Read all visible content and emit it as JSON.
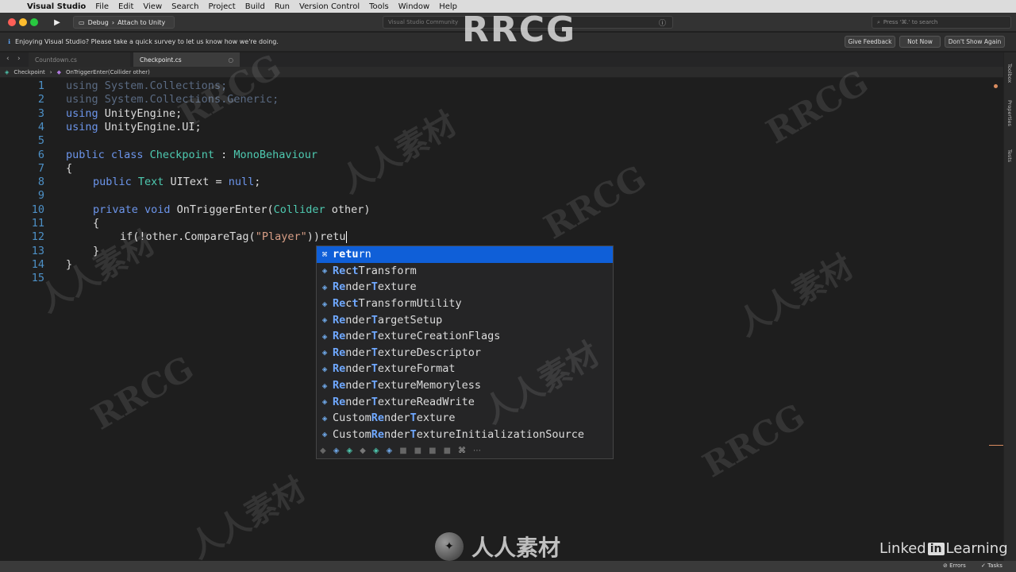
{
  "menubar": {
    "app": "Visual Studio",
    "items": [
      "File",
      "Edit",
      "View",
      "Search",
      "Project",
      "Build",
      "Run",
      "Version Control",
      "Tools",
      "Window",
      "Help"
    ]
  },
  "toolbar": {
    "config": "Debug",
    "target": "Attach to Unity",
    "status": "Visual Studio Community",
    "search_placeholder": "Press '⌘.' to search"
  },
  "infobar": {
    "message": "Enjoying Visual Studio? Please take a quick survey to let us know how we're doing.",
    "buttons": [
      "Give Feedback",
      "Not Now",
      "Don't Show Again"
    ]
  },
  "tabs": [
    {
      "label": "Countdown.cs",
      "active": false
    },
    {
      "label": "Checkpoint.cs",
      "active": true
    }
  ],
  "breadcrumb": [
    "Checkpoint",
    "OnTriggerEnter(Collider other)"
  ],
  "right_panels": [
    "Toolbox",
    "Properties",
    "Tests"
  ],
  "line_numbers": [
    "1",
    "2",
    "3",
    "4",
    "5",
    "6",
    "7",
    "8",
    "9",
    "10",
    "11",
    "12",
    "13",
    "14",
    "15"
  ],
  "code": {
    "l1_kw": "using",
    "l1_rest": " System.Collections;",
    "l2_kw": "using",
    "l2_rest": " System.Collections.Generic;",
    "l3_kw": "using",
    "l3_rest": " UnityEngine;",
    "l4_kw": "using",
    "l4_rest": " UnityEngine.UI;",
    "l6_kw": "public class",
    "l6_name": " Checkpoint",
    "l6_sep": " : ",
    "l6_base": "MonoBehaviour",
    "l7": "{",
    "l8_kw": "public",
    "l8_type": " Text",
    "l8_rest": " UIText = ",
    "l8_null": "null",
    "l8_end": ";",
    "l10_kw": "private void",
    "l10_name": " OnTriggerEnter(",
    "l10_type": "Collider",
    "l10_end": " other)",
    "l11": "{",
    "l12_a": "if(!other.CompareTag(",
    "l12_str": "\"Player\"",
    "l12_b": "))retu",
    "l13": "}",
    "l14": "}"
  },
  "completion": {
    "items": [
      {
        "icon": "⌘",
        "pre": "",
        "hl1": "retu",
        "mid": "rn",
        "hl2": "",
        "post": "",
        "selected": true
      },
      {
        "icon": "◈",
        "pre": "",
        "hl1": "Re",
        "mid": "c",
        "hl2": "t",
        "post": "Transform"
      },
      {
        "icon": "◈",
        "pre": "",
        "hl1": "Re",
        "mid": "nder",
        "hl2": "T",
        "post": "exture"
      },
      {
        "icon": "◈",
        "pre": "",
        "hl1": "Re",
        "mid": "c",
        "hl2": "t",
        "post": "TransformUtility"
      },
      {
        "icon": "◈",
        "pre": "",
        "hl1": "Re",
        "mid": "nder",
        "hl2": "T",
        "post": "argetSetup"
      },
      {
        "icon": "◈",
        "pre": "",
        "hl1": "Re",
        "mid": "nder",
        "hl2": "T",
        "post": "extureCreationFlags"
      },
      {
        "icon": "◈",
        "pre": "",
        "hl1": "Re",
        "mid": "nder",
        "hl2": "T",
        "post": "extureDescriptor"
      },
      {
        "icon": "◈",
        "pre": "",
        "hl1": "Re",
        "mid": "nder",
        "hl2": "T",
        "post": "extureFormat"
      },
      {
        "icon": "◈",
        "pre": "",
        "hl1": "Re",
        "mid": "nder",
        "hl2": "T",
        "post": "extureMemoryless"
      },
      {
        "icon": "◈",
        "pre": "",
        "hl1": "Re",
        "mid": "nder",
        "hl2": "T",
        "post": "extureReadWrite"
      },
      {
        "icon": "◈",
        "pre": "Custom",
        "hl1": "Re",
        "mid": "nder",
        "hl2": "T",
        "post": "exture"
      },
      {
        "icon": "◈",
        "pre": "Custom",
        "hl1": "Re",
        "mid": "nder",
        "hl2": "T",
        "post": "extureInitializationSource"
      }
    ],
    "filter_icons": [
      "◆",
      "◈",
      "◈",
      "◆",
      "◈",
      "◈",
      "■",
      "■",
      "■",
      "■",
      "⌘",
      "⋯"
    ]
  },
  "statusbar": {
    "errors": "Errors",
    "tasks": "Tasks"
  },
  "watermarks": {
    "top": "RRCG",
    "site": "人人素材",
    "brand_a": "Linked",
    "brand_in": "in",
    "brand_b": " Learning"
  },
  "colors": {
    "keyword": "#6c95eb",
    "type": "#4ec9b0",
    "string": "#d69d85",
    "selection": "#0f5fd8",
    "line_number": "#4d90c6"
  }
}
